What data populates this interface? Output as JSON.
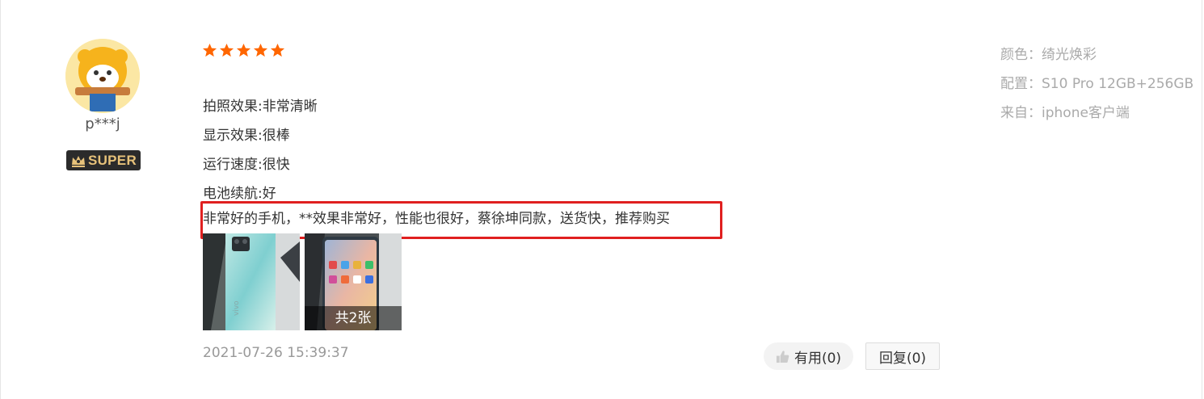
{
  "user": {
    "name": "p***j",
    "badge": "SUPER"
  },
  "review": {
    "rating": 5,
    "attributes": [
      "拍照效果:非常清晰",
      "显示效果:很棒",
      "运行速度:很快",
      "电池续航:好"
    ],
    "content": "非常好的手机，**效果非常好，性能也很好，蔡徐坤同款，送货快，推荐购买",
    "images_count_label": "共2张",
    "timestamp": "2021-07-26 15:39:37"
  },
  "actions": {
    "useful_label": "有用(0)",
    "reply_label": "回复(0)"
  },
  "meta": {
    "color_line": "颜色：绮光焕彩",
    "config_line": "配置：S10 Pro 12GB+256GB",
    "source_line": "来自：iphone客户端"
  },
  "colors": {
    "star": "#ff6600",
    "highlight_border": "#e02020",
    "badge_bg": "#2b2b2b",
    "badge_text": "#e7c27a",
    "meta_text": "#aaaaaa",
    "timestamp_text": "#999999"
  },
  "icons": {
    "star": "star-icon",
    "like": "thumbs-up-icon",
    "crown": "crown-icon"
  }
}
